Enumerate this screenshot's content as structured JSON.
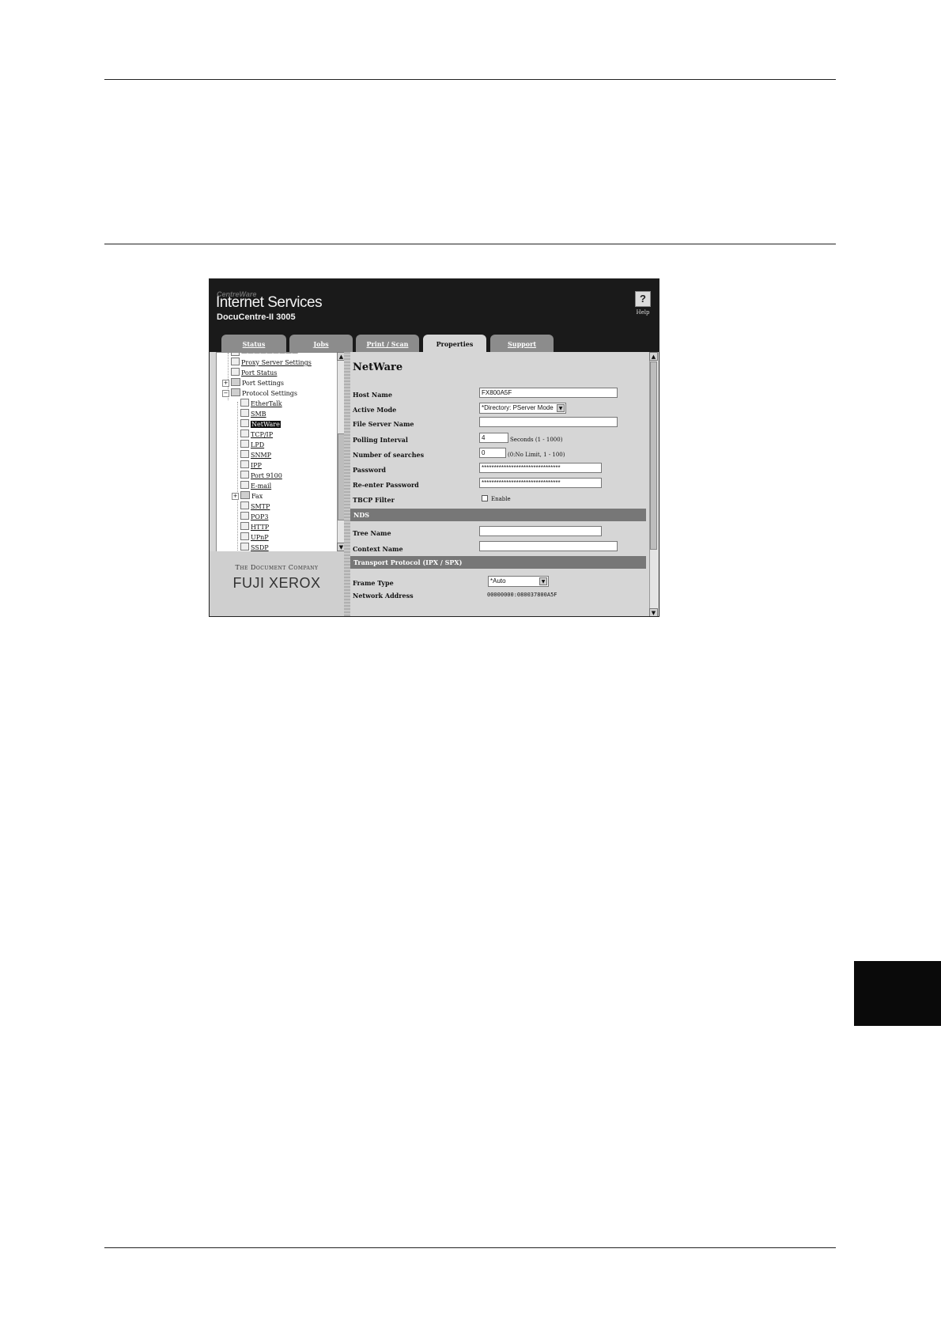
{
  "window": {
    "brand_small": "CentreWare",
    "brand_main": "Internet Services",
    "device": "DocuCentre-II 3005",
    "help_label": "Help",
    "help_glyph": "?"
  },
  "tabs": [
    {
      "label": "Status",
      "active": false
    },
    {
      "label": "Jobs",
      "active": false
    },
    {
      "label": "Print / Scan",
      "active": false
    },
    {
      "label": "Properties",
      "active": true
    },
    {
      "label": "Support",
      "active": false
    }
  ],
  "tree": {
    "items": [
      {
        "label": "Proxy Server Settings",
        "icon": "page-icon"
      },
      {
        "label": "Port Status",
        "icon": "page-icon"
      },
      {
        "label": "Port Settings",
        "icon": "folder-icon",
        "toggle": "+"
      },
      {
        "label": "Protocol Settings",
        "icon": "folder-open-icon",
        "toggle": "−"
      },
      {
        "label": "EtherTalk",
        "icon": "page-icon"
      },
      {
        "label": "SMB",
        "icon": "page-icon"
      },
      {
        "label": "NetWare",
        "icon": "page-icon",
        "selected": true
      },
      {
        "label": "TCP/IP",
        "icon": "page-icon"
      },
      {
        "label": "LPD",
        "icon": "page-icon"
      },
      {
        "label": "SNMP",
        "icon": "page-icon"
      },
      {
        "label": "IPP",
        "icon": "page-icon"
      },
      {
        "label": "Port 9100",
        "icon": "page-icon"
      },
      {
        "label": "E-mail",
        "icon": "page-icon"
      },
      {
        "label": "Fax",
        "icon": "folder-icon",
        "toggle": "+"
      },
      {
        "label": "SMTP",
        "icon": "page-icon"
      },
      {
        "label": "POP3",
        "icon": "page-icon"
      },
      {
        "label": "HTTP",
        "icon": "page-icon"
      },
      {
        "label": "UPnP",
        "icon": "page-icon"
      },
      {
        "label": "SSDP",
        "icon": "page-icon"
      }
    ],
    "scroll_up": "▲",
    "scroll_down": "▼"
  },
  "logo": {
    "top": "The Document Company",
    "main": "FUJI XEROX"
  },
  "form": {
    "title": "NetWare",
    "host_name_label": "Host Name",
    "host_name_value": "FX800A5F",
    "active_mode_label": "Active Mode",
    "active_mode_value": "*Directory: PServer Mode",
    "file_server_label": "File Server Name",
    "file_server_value": "",
    "polling_label": "Polling Interval",
    "polling_value": "4",
    "polling_hint": "Seconds (1 - 1000)",
    "searches_label": "Number of searches",
    "searches_value": "0",
    "searches_hint": "(0:No Limit, 1 - 100)",
    "password_label": "Password",
    "password_value": "********************************",
    "reenter_label": "Re-enter Password",
    "reenter_value": "********************************",
    "tbcp_label": "TBCP Filter",
    "tbcp_option": "Enable",
    "tbcp_checked": false,
    "nds_header": "NDS",
    "tree_name_label": "Tree Name",
    "tree_name_value": "",
    "context_label": "Context Name",
    "context_value": "",
    "transport_header": "Transport Protocol (IPX / SPX)",
    "frame_type_label": "Frame Type",
    "frame_type_value": "*Auto",
    "network_address_label": "Network Address",
    "network_address_value": "00000000:080037800A5F",
    "select_arrow": "▼"
  }
}
